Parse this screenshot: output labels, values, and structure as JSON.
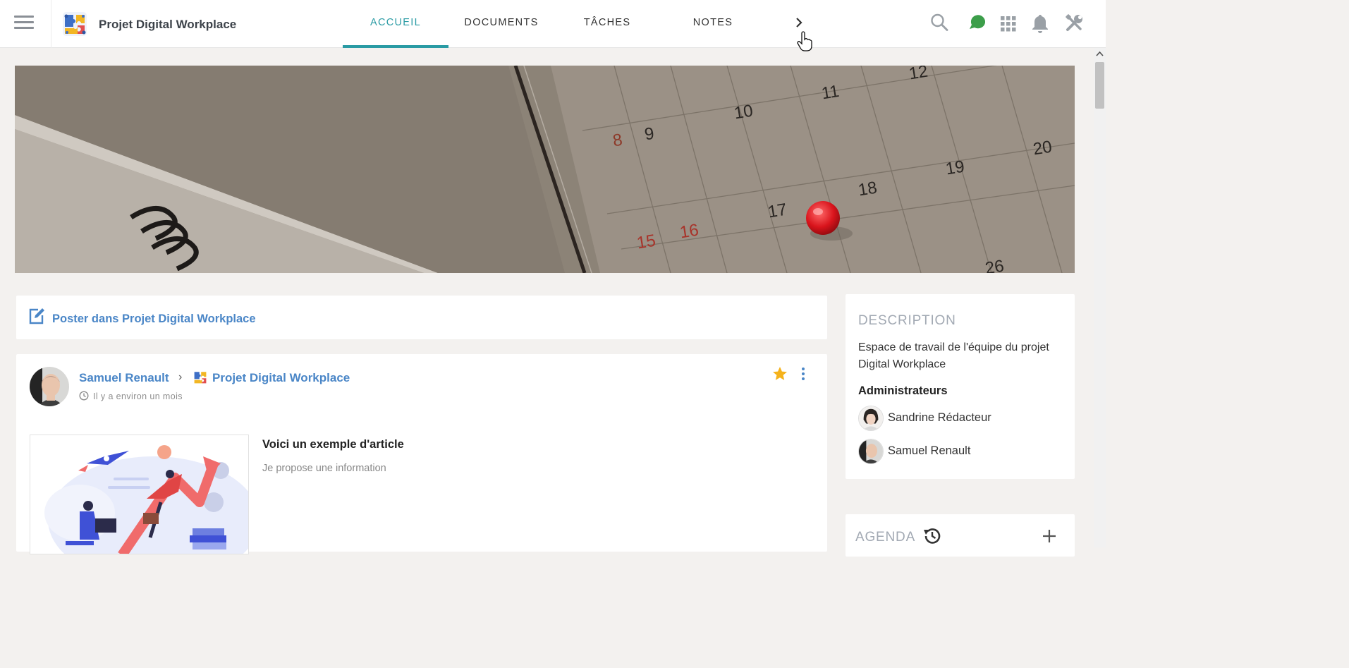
{
  "header": {
    "space_title": "Projet Digital Workplace",
    "tabs": [
      {
        "label": "ACCUEIL",
        "active": true
      },
      {
        "label": "DOCUMENTS",
        "active": false
      },
      {
        "label": "TÂCHES",
        "active": false
      },
      {
        "label": "NOTES",
        "active": false
      }
    ],
    "icons": [
      "menu-icon",
      "space-logo",
      "chevron-right-icon",
      "search-icon",
      "chat-icon",
      "apps-grid-icon",
      "bell-icon",
      "tools-icon"
    ]
  },
  "banner": {
    "calendar_numbers": [
      "8",
      "9",
      "10",
      "11",
      "12",
      "15",
      "16",
      "17",
      "18",
      "19",
      "20",
      "26"
    ]
  },
  "composer": {
    "label": "Poster dans Projet Digital Workplace"
  },
  "activity": {
    "author": "Samuel Renault",
    "space": "Projet Digital Workplace",
    "time": "Il y a environ un mois",
    "article_title": "Voici un exemple d'article",
    "article_summary": "Je propose une information"
  },
  "description": {
    "heading": "DESCRIPTION",
    "text": "Espace de travail de l'équipe du projet Digital Workplace",
    "admins_heading": "Administrateurs",
    "admins": [
      "Sandrine Rédacteur",
      "Samuel Renault"
    ]
  },
  "agenda": {
    "heading": "AGENDA"
  },
  "colors": {
    "accent": "#2a9ba4",
    "link": "#4a86c7",
    "background": "#f3f1ef",
    "star": "#f5b21b",
    "chat": "#3c9e4a"
  }
}
